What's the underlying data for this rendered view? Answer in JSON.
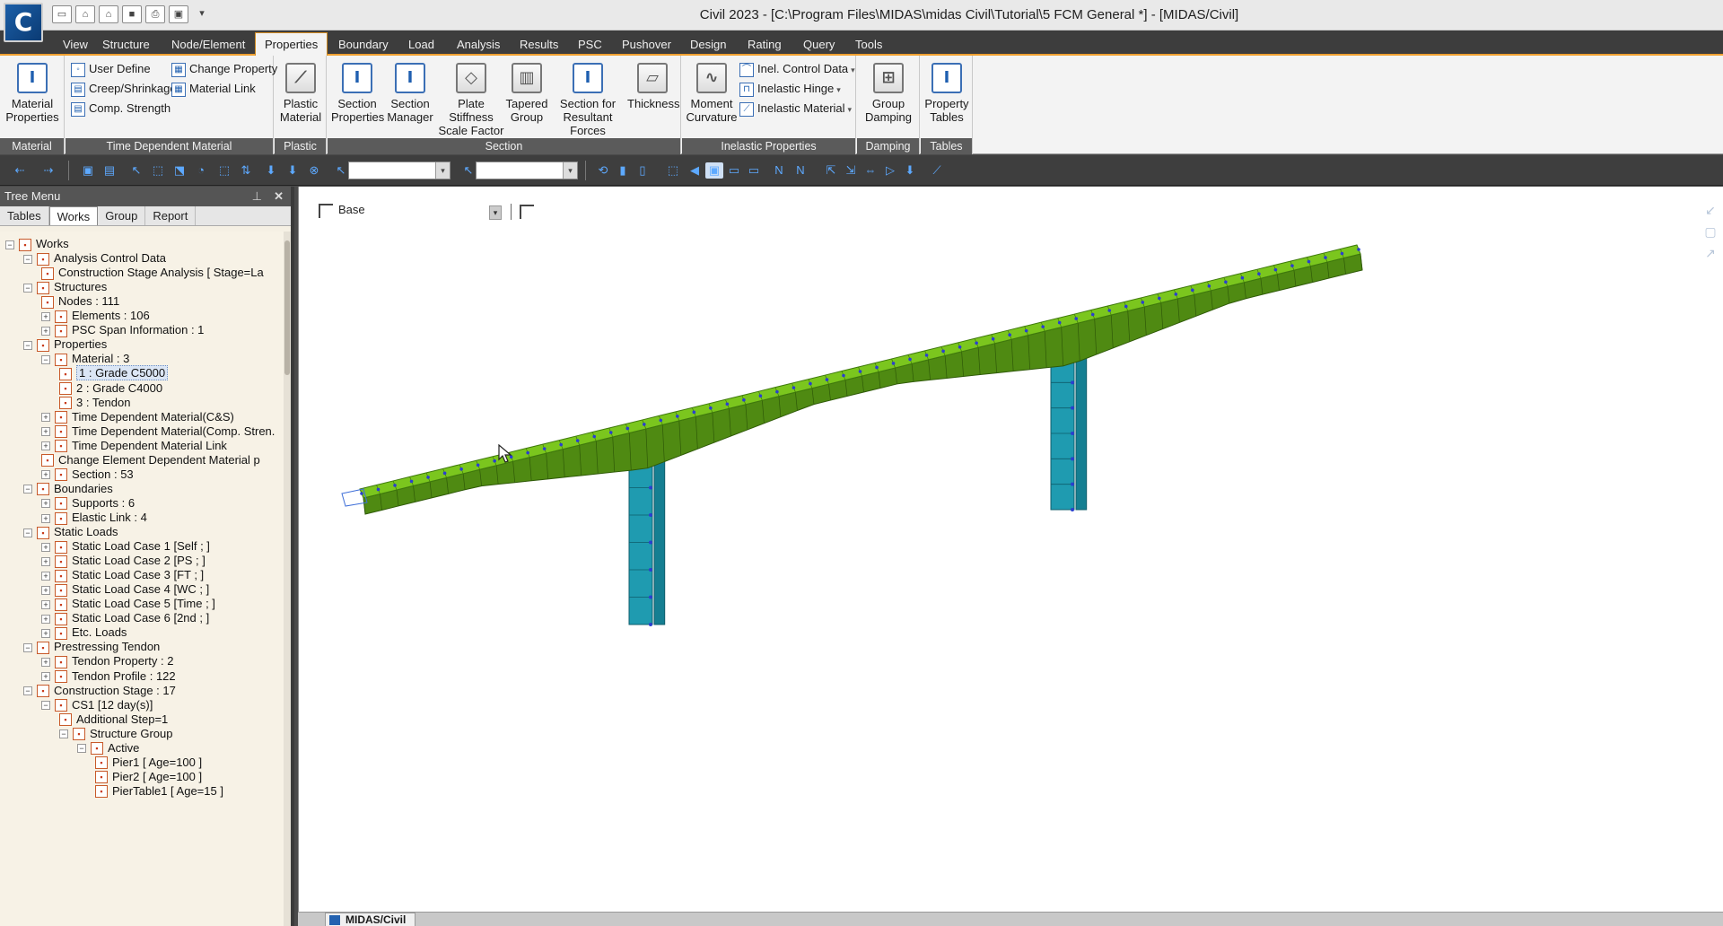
{
  "window": {
    "title": "Civil 2023 - [C:\\Program Files\\MIDAS\\midas Civil\\Tutorial\\5 FCM General *] - [MIDAS/Civil]",
    "logo_letter": "C"
  },
  "ribbon_tabs": [
    "View",
    "Structure",
    "Node/Element",
    "Properties",
    "Boundary",
    "Load",
    "Analysis",
    "Results",
    "PSC",
    "Pushover",
    "Design",
    "Rating",
    "Query",
    "Tools"
  ],
  "active_tab": "Properties",
  "ribbon": {
    "material_group": {
      "label": "Material",
      "material_properties": "Material\nProperties"
    },
    "tdm_group": {
      "label": "Time Dependent Material",
      "user_define": "User Define",
      "creep_shrinkage": "Creep/Shrinkage",
      "comp_strength": "Comp. Strength",
      "change_property": "Change Property",
      "material_link": "Material Link"
    },
    "plastic_group": {
      "label": "Plastic",
      "plastic_material": "Plastic\nMaterial"
    },
    "section_group": {
      "label": "Section",
      "section_properties": "Section\nProperties",
      "section_manager": "Section\nManager",
      "plate_stiffness": "Plate Stiffness\nScale Factor",
      "tapered_group": "Tapered\nGroup",
      "section_resultant": "Section for\nResultant Forces",
      "thickness": "Thickness"
    },
    "inelastic_group": {
      "label": "Inelastic Properties",
      "moment_curvature": "Moment\nCurvature",
      "inel_control": "Inel. Control Data",
      "inelastic_hinge": "Inelastic Hinge",
      "inelastic_material": "Inelastic Material"
    },
    "damping_group": {
      "label": "Damping",
      "group_damping": "Group\nDamping"
    },
    "tables_group": {
      "label": "Tables",
      "property_tables": "Property\nTables"
    }
  },
  "tree_menu": {
    "title": "Tree Menu",
    "tabs": [
      "Tables",
      "Works",
      "Group",
      "Report"
    ],
    "active_tab": "Works",
    "nodes": [
      {
        "label": "Works",
        "level": 0
      },
      {
        "label": "Analysis Control Data",
        "level": 1
      },
      {
        "label": "Construction Stage Analysis [ Stage=La",
        "level": 2
      },
      {
        "label": "Structures",
        "level": 1
      },
      {
        "label": "Nodes : 111",
        "level": 2
      },
      {
        "label": "Elements : 106",
        "level": 2
      },
      {
        "label": "PSC Span Information : 1",
        "level": 2
      },
      {
        "label": "Properties",
        "level": 1
      },
      {
        "label": "Material : 3",
        "level": 2
      },
      {
        "label": "1 : Grade C5000",
        "level": 3,
        "selected": true
      },
      {
        "label": "2 : Grade C4000",
        "level": 3
      },
      {
        "label": "3 : Tendon",
        "level": 3
      },
      {
        "label": "Time Dependent Material(C&S)",
        "level": 2
      },
      {
        "label": "Time Dependent Material(Comp. Stren.",
        "level": 2
      },
      {
        "label": "Time Dependent Material Link",
        "level": 2
      },
      {
        "label": "Change Element Dependent Material p",
        "level": 2
      },
      {
        "label": "Section : 53",
        "level": 2
      },
      {
        "label": "Boundaries",
        "level": 1
      },
      {
        "label": "Supports : 6",
        "level": 2
      },
      {
        "label": "Elastic Link : 4",
        "level": 2
      },
      {
        "label": "Static Loads",
        "level": 1
      },
      {
        "label": "Static Load Case 1 [Self ; ]",
        "level": 2
      },
      {
        "label": "Static Load Case 2 [PS ; ]",
        "level": 2
      },
      {
        "label": "Static Load Case 3 [FT ; ]",
        "level": 2
      },
      {
        "label": "Static Load Case 4 [WC ; ]",
        "level": 2
      },
      {
        "label": "Static Load Case 5 [Time ; ]",
        "level": 2
      },
      {
        "label": "Static Load Case 6 [2nd ; ]",
        "level": 2
      },
      {
        "label": "Etc. Loads",
        "level": 2
      },
      {
        "label": "Prestressing Tendon",
        "level": 1
      },
      {
        "label": "Tendon Property : 2",
        "level": 2
      },
      {
        "label": "Tendon Profile : 122",
        "level": 2
      },
      {
        "label": "Construction Stage : 17",
        "level": 1
      },
      {
        "label": "CS1 [12 day(s)]",
        "level": 2
      },
      {
        "label": "Additional Step=1",
        "level": 3
      },
      {
        "label": "Structure Group",
        "level": 3
      },
      {
        "label": "Active",
        "level": 4
      },
      {
        "label": "Pier1 [ Age=100 ]",
        "level": 5
      },
      {
        "label": "Pier2 [ Age=100 ]",
        "level": 5
      },
      {
        "label": "PierTable1 [ Age=15 ]",
        "level": 5
      }
    ]
  },
  "view": {
    "base_label": "Base",
    "doc_tab": "MIDAS/Civil"
  },
  "colors": {
    "deck": "#7bc61e",
    "deck_dark": "#4f8a12",
    "pier": "#1f9bb0",
    "node": "#2a3fd0"
  }
}
